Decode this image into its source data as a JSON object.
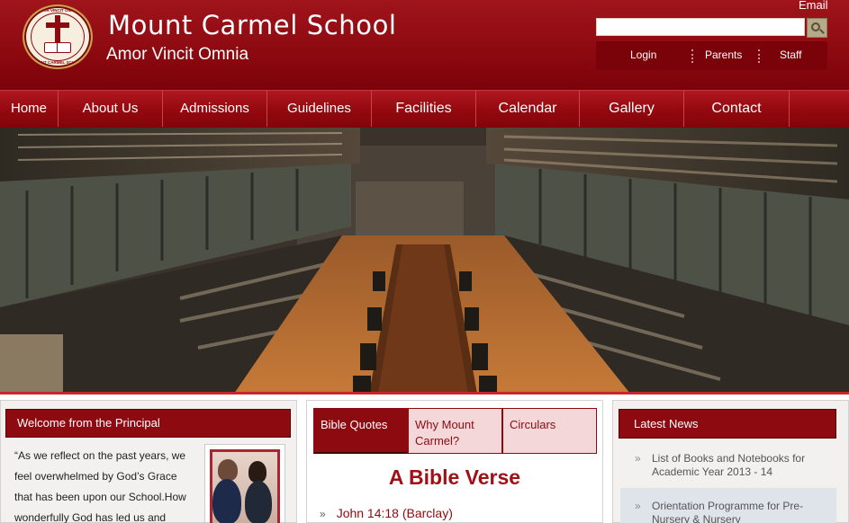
{
  "header": {
    "school_name": "Mount Carmel School",
    "motto": "Amor Vincit Omnia",
    "logo": {
      "top_text": "AMOR VINCIT OMNIA",
      "bottom_text": "MOUNT CARMEL SCHOOL"
    },
    "email_label": "Email",
    "search": {
      "value": "",
      "placeholder": ""
    },
    "search_button_icon": "magnifier-icon",
    "links": {
      "login": "Login",
      "parents": "Parents",
      "staff": "Staff"
    }
  },
  "nav": {
    "items": [
      "Home",
      "About Us",
      "Admissions",
      "Guidelines",
      "Facilities",
      "Calendar",
      "Gallery",
      "Contact"
    ]
  },
  "welcome": {
    "heading": "Welcome from the Principal",
    "text": "“As we reflect on the past years, we feel overwhelmed by God’s Grace that has been upon our School.How wonderfully God has led us and"
  },
  "middle": {
    "tabs": [
      "Bible Quotes",
      "Why Mount Carmel?",
      "Circulars"
    ],
    "active_tab": "Bible Quotes",
    "heading": "A Bible Verse",
    "verse_bullet": "»",
    "verse_ref": "John 14:18 (Barclay)"
  },
  "news": {
    "heading": "Latest News",
    "bullet": "»",
    "items": [
      "List of Books and Notebooks for Academic Year 2013 - 14",
      "Orientation Programme for Pre-Nursery & Nursery"
    ]
  },
  "colors": {
    "brand": "#8e0a11",
    "brand_dark": "#7c0209",
    "tab_inactive": "#f3d7d9"
  }
}
